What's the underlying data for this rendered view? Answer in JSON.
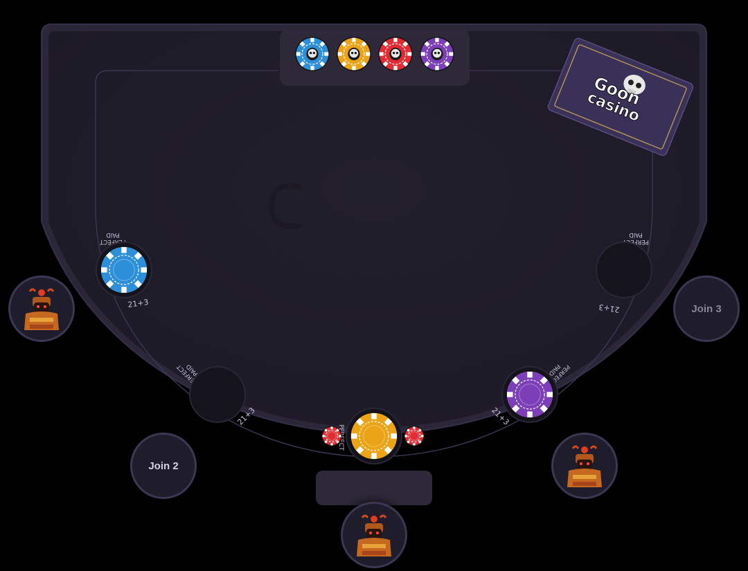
{
  "brand": {
    "name_line1": "Goon",
    "name_line2": "casino"
  },
  "chip_tray": {
    "chips": [
      {
        "color": "#2d8fd8",
        "icon": "skull-icon"
      },
      {
        "color": "#eba417",
        "icon": "skull-icon"
      },
      {
        "color": "#e12c33",
        "icon": "skull-icon"
      },
      {
        "color": "#7c3fb8",
        "icon": "skull-icon"
      }
    ]
  },
  "side_bets": {
    "perfect_pairs_line1": "PERFECT",
    "perfect_pairs_line2": "PAID",
    "twenty_one_plus_three": "21+3",
    "perfect_short": "PERFECT"
  },
  "seats": [
    {
      "id": "seat-left-top",
      "occupied": true,
      "label": ""
    },
    {
      "id": "seat-left-bottom",
      "occupied": false,
      "label": "Join 2"
    },
    {
      "id": "seat-center",
      "occupied": true,
      "label": ""
    },
    {
      "id": "seat-right-bottom",
      "occupied": true,
      "label": ""
    },
    {
      "id": "seat-right-top",
      "occupied": false,
      "label": "Join 3"
    }
  ],
  "colors": {
    "felt": "#221f2e",
    "rim": "#2b2739",
    "chip_blue": "#2d8fd8",
    "chip_orange": "#eba417",
    "chip_red": "#e12c33",
    "chip_purple": "#7c3fb8"
  }
}
